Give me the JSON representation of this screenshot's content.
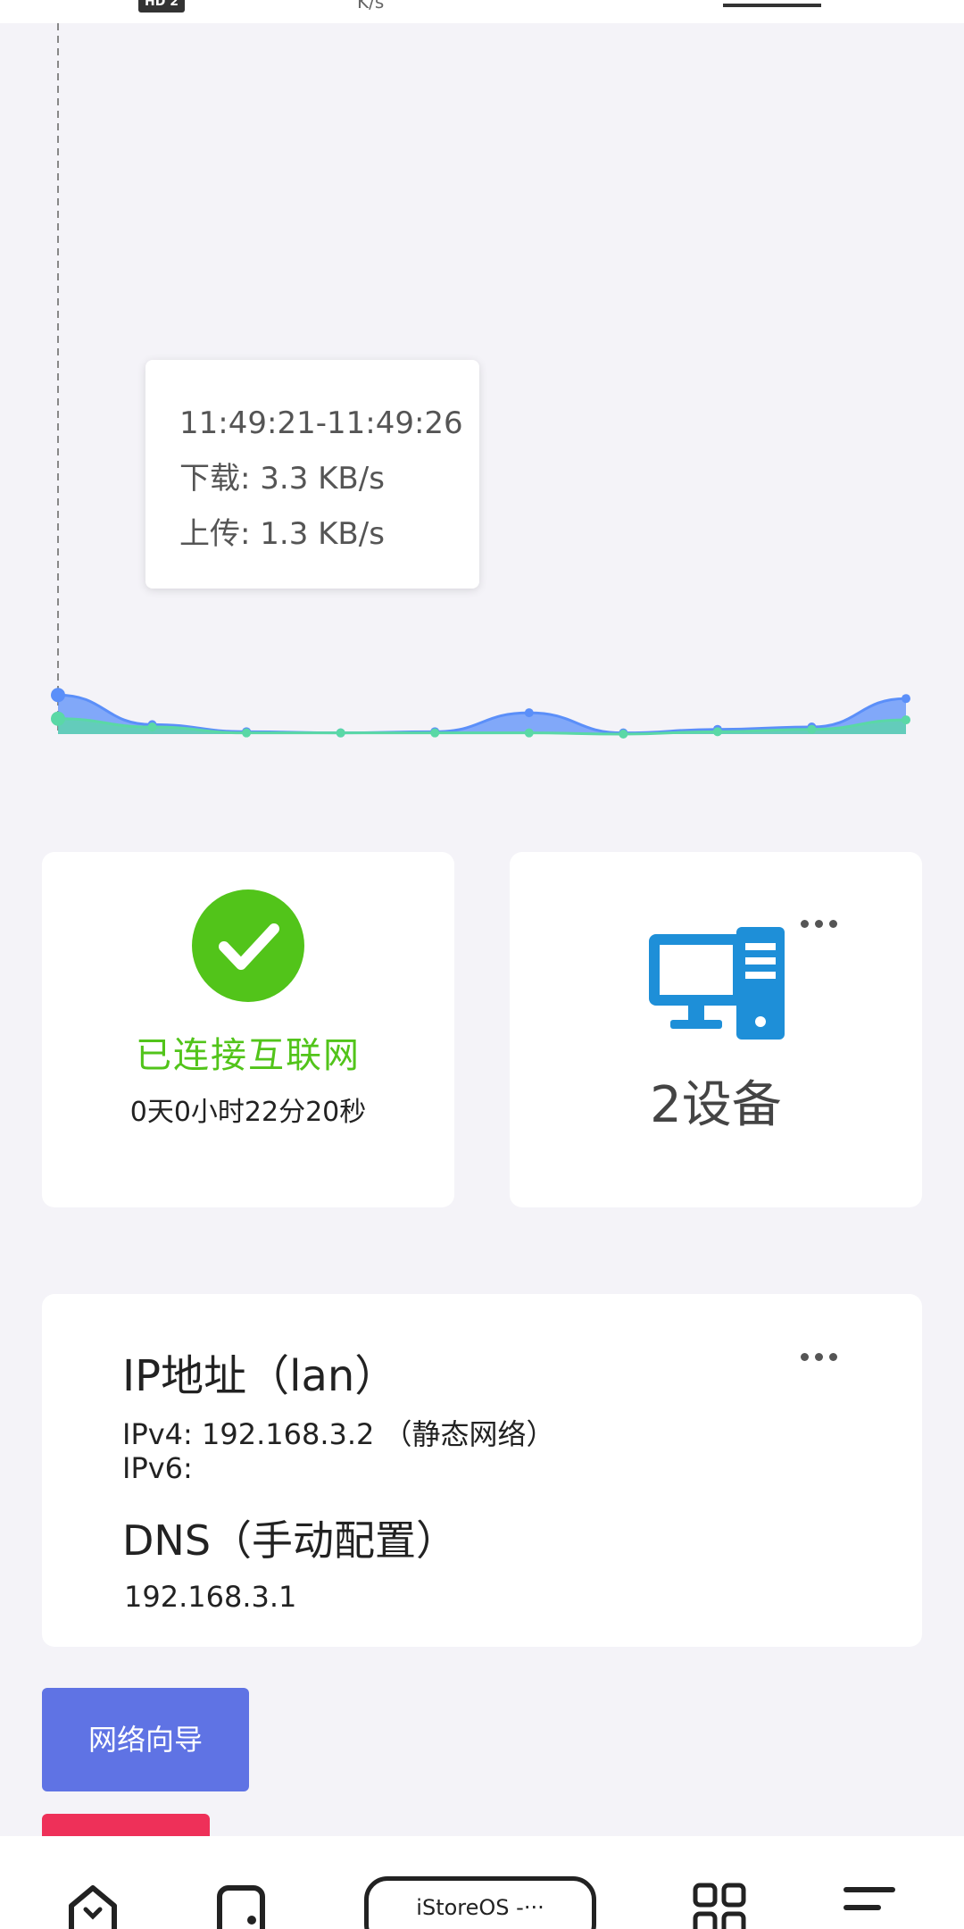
{
  "status_bar": {
    "network_badge": "HD 2",
    "speed_unit": "K/s"
  },
  "chart_data": {
    "type": "line",
    "title": "",
    "xlabel": "",
    "ylabel": "",
    "x": [
      0,
      1,
      2,
      3,
      4,
      5,
      6,
      7,
      8,
      9
    ],
    "series": [
      {
        "name": "下载",
        "values": [
          3.3,
          0.8,
          0.2,
          0.1,
          0.2,
          1.8,
          0.1,
          0.4,
          0.6,
          3.0
        ]
      },
      {
        "name": "上传",
        "values": [
          1.3,
          0.6,
          0.1,
          0.1,
          0.1,
          0.1,
          0.0,
          0.2,
          0.4,
          1.2
        ]
      }
    ],
    "colors": [
      "#5b8ff9",
      "#5ad8a6"
    ],
    "ylim": [
      0,
      60
    ],
    "grid": false,
    "legend": "none",
    "tooltip": {
      "time_range": "11:49:21-11:49:26",
      "download": "下载: 3.3 KB/s",
      "upload": "上传: 1.3 KB/s"
    }
  },
  "internet_card": {
    "status": "已连接互联网",
    "uptime": "0天0小时22分20秒",
    "status_color": "#52c41a"
  },
  "devices_card": {
    "count_label": "2设备",
    "icon": "computer-icon",
    "icon_color": "#1e8fd8"
  },
  "ip_card": {
    "title": "IP地址（lan）",
    "ipv4": "IPv4:  192.168.3.2 （静态网络）",
    "ipv6": "IPv6:",
    "dns_title": "DNS（手动配置）",
    "dns_value": "192.168.3.1"
  },
  "actions": {
    "wizard_label": "网络向导",
    "wizard_color": "#5f73e4",
    "red_button_color": "#ee3059"
  },
  "bottom_nav": {
    "center_tab_label": "iStoreOS -···"
  }
}
